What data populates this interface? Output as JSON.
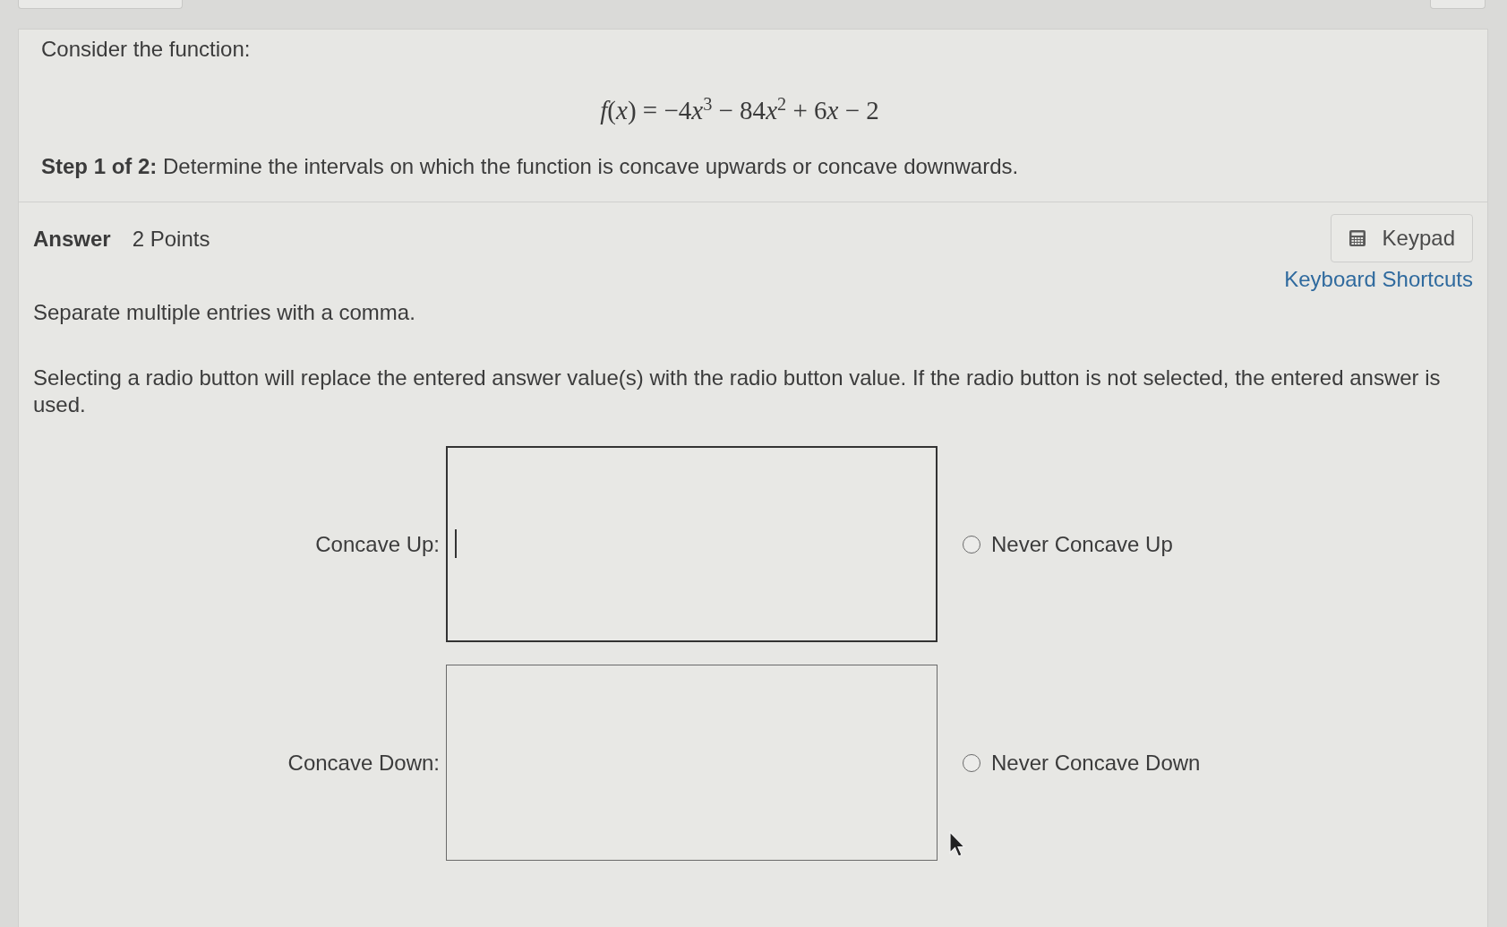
{
  "question": {
    "intro": "Consider the function:",
    "formula": "f(x) = −4x$^{3}$ − 84x$^{2}$ + 6x − 2",
    "step": "**Step 1 of 2:** Determine the intervals on which the function is concave upwards or concave downwards."
  },
  "answer": {
    "title": "Answer",
    "points": "2 Points",
    "keypad_button": "Keypad",
    "shortcuts_link": "Keyboard Shortcuts",
    "instructions": [
      "Separate multiple entries with a comma.",
      "Selecting a radio button will replace the entered answer value(s) with the radio button value. If the radio button is not selected, the entered answer is used."
    ],
    "fields": [
      {
        "label": "Concave Up:",
        "focused": true,
        "option": {
          "label": "Never Concave Up",
          "selected": false
        }
      },
      {
        "label": "Concave Down:",
        "focused": false,
        "option": {
          "label": "Never Concave Down",
          "selected": false
        }
      }
    ]
  }
}
